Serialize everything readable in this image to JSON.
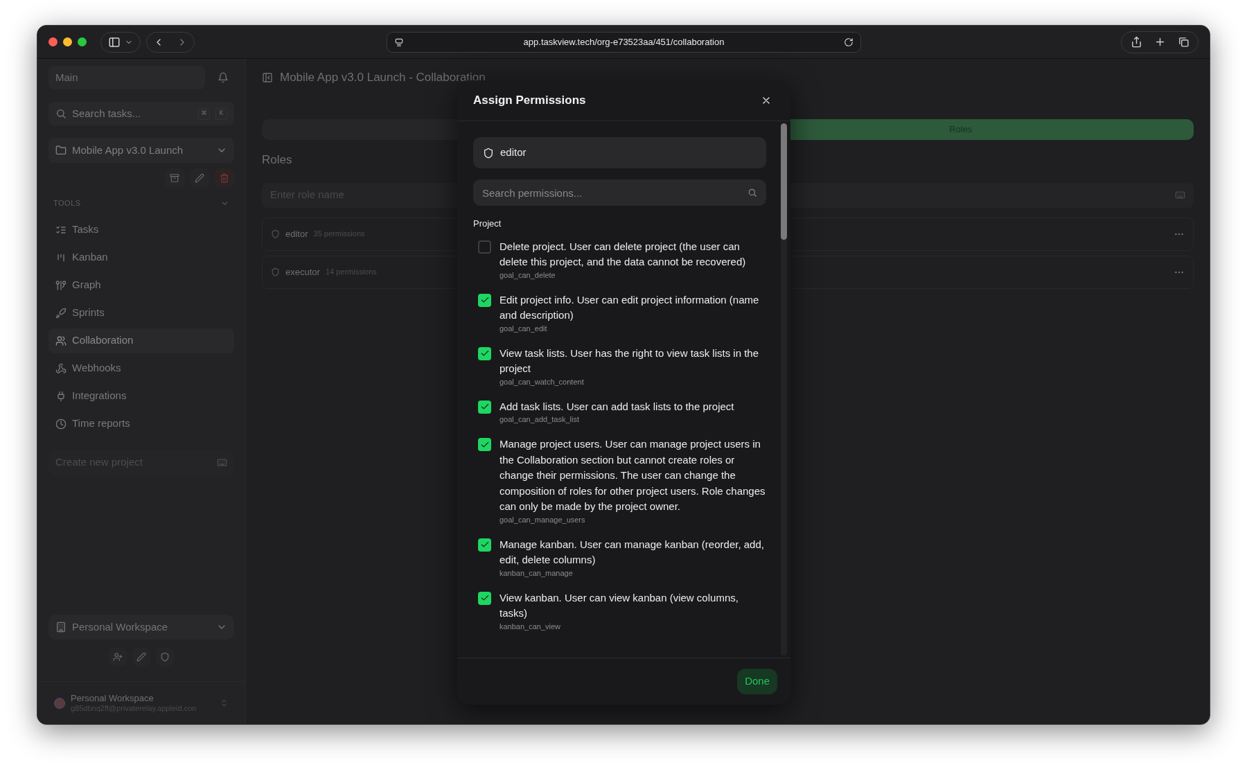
{
  "browser": {
    "url": "app.taskview.tech/org-e73523aa/451/collaboration"
  },
  "sidebar": {
    "workspace_field": "Main",
    "search": {
      "placeholder": "Search tasks...",
      "shortcut": [
        "⌘",
        "K"
      ]
    },
    "project": "Mobile App v3.0 Launch",
    "section": "TOOLS",
    "items": [
      {
        "label": "Tasks",
        "selected": false
      },
      {
        "label": "Kanban",
        "selected": false
      },
      {
        "label": "Graph",
        "selected": false
      },
      {
        "label": "Sprints",
        "selected": false
      },
      {
        "label": "Collaboration",
        "selected": true
      },
      {
        "label": "Webhooks",
        "selected": false
      },
      {
        "label": "Integrations",
        "selected": false
      },
      {
        "label": "Time reports",
        "selected": false
      }
    ],
    "create_project": {
      "placeholder": "Create new project"
    },
    "workspace": "Personal Workspace",
    "user": {
      "name": "Personal Workspace",
      "email": "g85dbnq2ff@privaterelay.appleid.con"
    }
  },
  "main": {
    "title": "Mobile App v3.0 Launch - Collaboration",
    "tabs": [
      {
        "label": "Roles",
        "selected": true
      }
    ],
    "heading": "Roles",
    "role_input": {
      "placeholder": "Enter role name"
    },
    "roles": [
      {
        "name": "editor",
        "count": "35 permissions"
      },
      {
        "name": "executor",
        "count": "14 permissions"
      }
    ]
  },
  "dialog": {
    "title": "Assign Permissions",
    "role": "editor",
    "search": {
      "placeholder": "Search permissions..."
    },
    "group": "Project",
    "permissions": [
      {
        "text": "Delete project. User can delete project (the user can delete this project, and the data cannot be recovered)",
        "code": "goal_can_delete",
        "checked": false
      },
      {
        "text": "Edit project info. User can edit project information (name and description)",
        "code": "goal_can_edit",
        "checked": true
      },
      {
        "text": "View task lists. User has the right to view task lists in the project",
        "code": "goal_can_watch_content",
        "checked": true
      },
      {
        "text": "Add task lists. User can add task lists to the project",
        "code": "goal_can_add_task_list",
        "checked": true
      },
      {
        "text": "Manage project users. User can manage project users in the Collaboration section but cannot create roles or change their permissions. The user can change the composition of roles for other project users. Role changes can only be made by the project owner.",
        "code": "goal_can_manage_users",
        "checked": true
      },
      {
        "text": "Manage kanban. User can manage kanban (reorder, add, edit, delete columns)",
        "code": "kanban_can_manage",
        "checked": true
      },
      {
        "text": "View kanban. User can view kanban (view columns, tasks)",
        "code": "kanban_can_view",
        "checked": true
      }
    ],
    "done": "Done"
  }
}
